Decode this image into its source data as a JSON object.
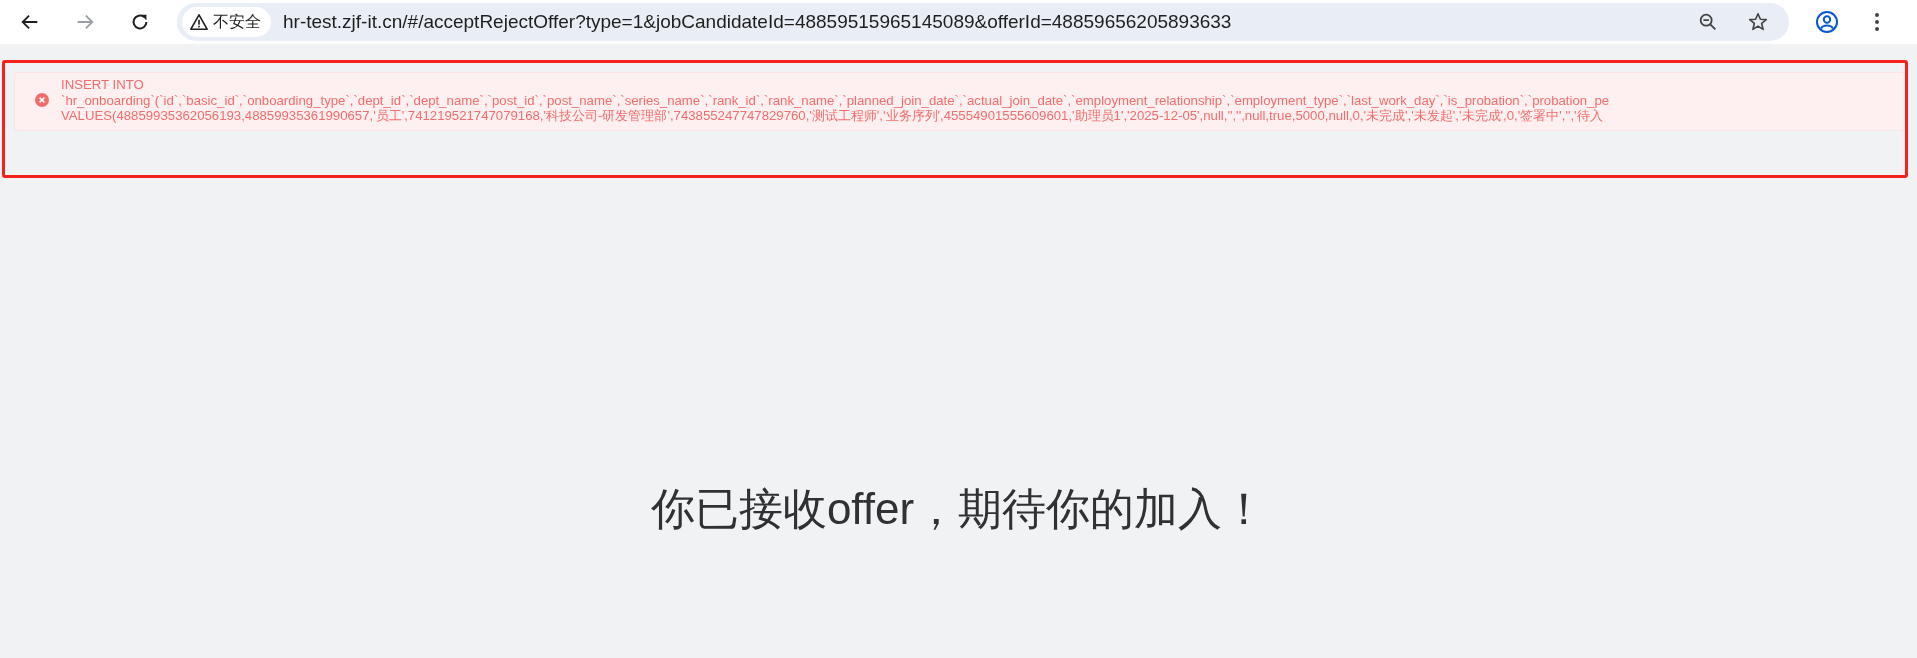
{
  "browser": {
    "nav": [
      {
        "kind": "back",
        "disabled": false
      },
      {
        "kind": "forward",
        "disabled": true
      },
      {
        "kind": "reload",
        "disabled": false
      }
    ],
    "security_label": "不安全",
    "url": "hr-test.zjf-it.cn/#/acceptRejectOffer?type=1&jobCandidateId=48859515965145089&offerId=48859656205893633"
  },
  "error_message": {
    "lines": [
      "INSERT INTO",
      "`hr_onboarding`(`id`,`basic_id`,`onboarding_type`,`dept_id`,`dept_name`,`post_id`,`post_name`,`series_name`,`rank_id`,`rank_name`,`planned_join_date`,`actual_join_date`,`employment_relationship`,`employment_type`,`last_work_day`,`is_probation`,`probation_pe",
      "VALUES(48859935362056193,48859935361990657,'员工',741219521747079168,'科技公司-研发管理部',743855247747829760,'测试工程师','业务序列',45554901555609601,'助理员1','2025-12-05',null,'','',null,true,5000,null,0,'未完成','未发起','未完成',0,'签署中','','待入"
    ]
  },
  "message": "你已接收offer，期待你的加入！"
}
